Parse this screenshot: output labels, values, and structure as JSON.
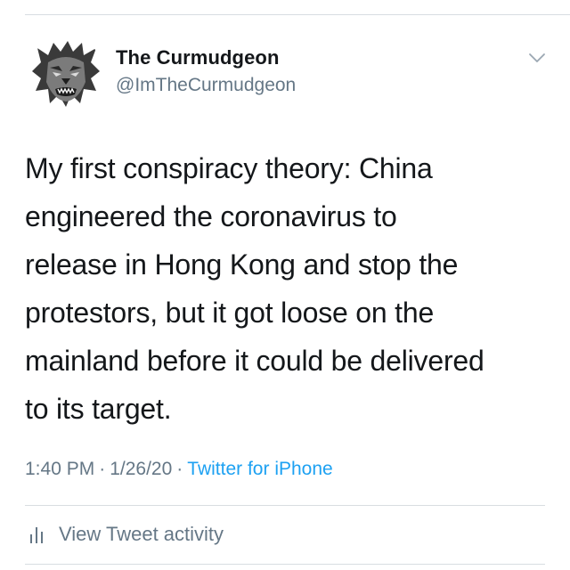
{
  "tweet": {
    "author": {
      "display_name": "The Curmudgeon",
      "handle": "@ImTheCurmudgeon",
      "avatar_icon": "grumpy-lion-avatar"
    },
    "text_lines": [
      "My first conspiracy theory: China",
      "engineered the coronavirus to",
      "release in Hong Kong and stop the",
      "protestors, but it got loose on the",
      "mainland before it could be delivered",
      "to its target."
    ],
    "time": "1:40 PM",
    "date": "1/26/20",
    "separator": "·",
    "source": "Twitter for iPhone",
    "menu_icon": "chevron-down-icon"
  },
  "activity": {
    "icon": "bar-chart-icon",
    "label": "View Tweet activity"
  },
  "colors": {
    "text": "#14171a",
    "secondary": "#657786",
    "link": "#1da1f2",
    "divider": "#d8dde1"
  }
}
